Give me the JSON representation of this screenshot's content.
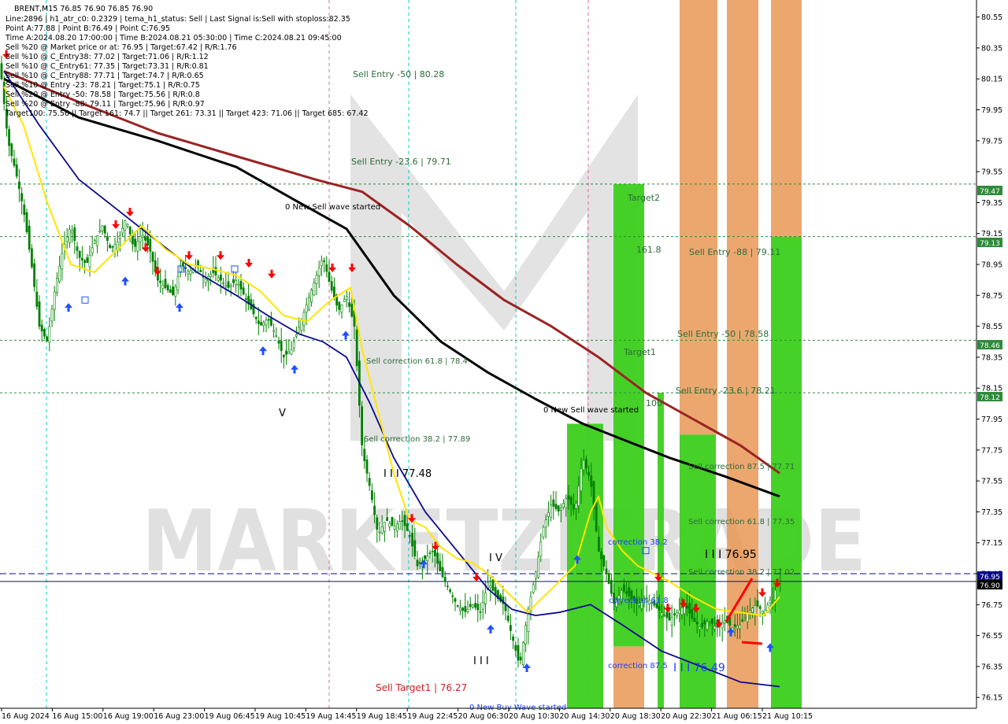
{
  "info_panel": {
    "line0": "BRENT,M15  76.85 76.90 76.85 76.90",
    "line1": "Line:2896 | h1_atr_c0: 0.2329 | tema_h1_status: Sell | Last Signal is:Sell with stoploss:82.35",
    "line2": "Point A:77.88 | Point B:76.49 | Point C:76.95",
    "line3": "Time A:2024.08.20 17:00:00 | Time B:2024.08.21 05:30:00 | Time C:2024.08.21 09:45:00",
    "line4": "Sell %20 @ Market price or at: 76.95 | Target:67.42 | R/R:1.76",
    "line5": "Sell %10 @ C_Entry38: 77.02 | Target:71.06 | R/R:1.12",
    "line6": "Sell %10 @ C_Entry61: 77.35 | Target:73.31 | R/R:0.81",
    "line7": "Sell %10 @ C_Entry88: 77.71 | Target:74.7 | R/R:0.65",
    "line8": "Sell %10 @ Entry -23: 78.21 | Target:75.1 | R/R:0.75",
    "line9": "Sell %20 @ Entry -50: 78.58 | Target:75.56 | R/R:0.8",
    "line10": "Sell %20 @ Entry -88: 79.11 | Target:75.96 | R/R:0.97",
    "line11": "Target100: 75.56 || Target 161: 74.7 || Target 261: 73.31 || Target 423: 71.06 || Target 685: 67.42"
  },
  "annotations": {
    "sell_entry_50_top": "Sell Entry -50 | 80.28",
    "sell_entry_236_top": "Sell Entry -23.6 | 79.71",
    "new_sell_wave_1": "0 New Sell wave started",
    "new_sell_wave_2": "0 New Sell wave started",
    "target2": "Target2",
    "fib_1618": "161.8",
    "target1": "Target1",
    "fib_100": "100",
    "sell_entry_88": "Sell Entry -88 | 79.11",
    "sell_entry_50": "Sell Entry -50 | 78.58",
    "sell_entry_236": "Sell Entry -23.6 | 78.21",
    "sell_corr_618_left": "Sell correction 61.8 | 78.4",
    "sell_corr_382_left": "Sell correction 38.2 | 77.89",
    "wave_iii_label": "I I I  77.48",
    "wave_v": "V",
    "wave_iv": "I V",
    "wave_iii_low": "I I I",
    "sell_target1": "Sell Target1 | 76.27",
    "new_buy_wave": "0 New Buy Wave started",
    "correction_382": "correction 38.2",
    "correction_618": "correction 61.8",
    "correction_875": "correction 87.5",
    "wave_iii_7649": "I I I  76.49",
    "sell_corr_875_right": "Sell correction 87.5 | 77.71",
    "sell_corr_618_right": "Sell correction 61.8 | 77.35",
    "sell_corr_382_right": "Sell correction 38.2 | 77.02",
    "wave_iii_7695": "I I I  76.95",
    "watermark": "MARKETZITRADE"
  },
  "price_badges": {
    "p7947": "79.47",
    "p7913": "79.13",
    "p7846": "78.46",
    "p7812": "78.12",
    "p7695": "76.95",
    "p7690": "76.90"
  },
  "colors": {
    "candle": "#008000",
    "ma_black": "#000000",
    "ma_red": "#9b2323",
    "ma_navy": "#0a0a8c",
    "ma_yellow": "#ffe600",
    "green_zone": "#3ccf1e",
    "orange_zone": "#e8944f",
    "sell_arrow": "#ff0000",
    "buy_arrow": "#1e50ff",
    "badge_green": "#2e8b3a",
    "badge_navy": "#0a0a8c"
  },
  "chart_data": {
    "type": "candlestick",
    "symbol": "BRENT",
    "timeframe": "M15",
    "ylim": [
      76.08,
      80.66
    ],
    "y_ticks": [
      "80.55",
      "80.35",
      "80.15",
      "79.95",
      "79.75",
      "79.55",
      "79.35",
      "79.15",
      "78.95",
      "78.75",
      "78.55",
      "78.35",
      "78.15",
      "77.95",
      "77.75",
      "77.55",
      "77.35",
      "77.15",
      "76.95",
      "76.75",
      "76.55",
      "76.35",
      "76.15"
    ],
    "x_ticks": [
      "16 Aug 2024",
      "16 Aug 15:00",
      "16 Aug 19:00",
      "16 Aug 23:00",
      "19 Aug 06:45",
      "19 Aug 10:45",
      "19 Aug 14:45",
      "19 Aug 18:45",
      "19 Aug 22:45",
      "20 Aug 06:30",
      "20 Aug 10:30",
      "20 Aug 14:30",
      "20 Aug 18:30",
      "20 Aug 22:30",
      "21 Aug 06:15",
      "21 Aug 10:15"
    ],
    "horizontal_levels": [
      79.47,
      79.13,
      78.46,
      78.12,
      76.95,
      76.9
    ],
    "close_path": [
      [
        0,
        80.25
      ],
      [
        10,
        79.75
      ],
      [
        20,
        79.55
      ],
      [
        30,
        79.3
      ],
      [
        40,
        78.95
      ],
      [
        50,
        78.55
      ],
      [
        60,
        78.45
      ],
      [
        70,
        78.8
      ],
      [
        80,
        79.05
      ],
      [
        90,
        79.2
      ],
      [
        100,
        79.0
      ],
      [
        110,
        78.95
      ],
      [
        120,
        79.1
      ],
      [
        130,
        79.2
      ],
      [
        140,
        79.05
      ],
      [
        150,
        79.1
      ],
      [
        160,
        79.25
      ],
      [
        170,
        79.05
      ],
      [
        180,
        79.15
      ],
      [
        190,
        79.05
      ],
      [
        200,
        78.85
      ],
      [
        210,
        78.8
      ],
      [
        220,
        78.75
      ],
      [
        230,
        78.95
      ],
      [
        240,
        78.9
      ],
      [
        250,
        78.95
      ],
      [
        260,
        78.85
      ],
      [
        270,
        78.9
      ],
      [
        280,
        78.85
      ],
      [
        290,
        78.8
      ],
      [
        300,
        78.85
      ],
      [
        310,
        78.75
      ],
      [
        320,
        78.65
      ],
      [
        330,
        78.55
      ],
      [
        340,
        78.6
      ],
      [
        350,
        78.5
      ],
      [
        360,
        78.35
      ],
      [
        370,
        78.4
      ],
      [
        380,
        78.55
      ],
      [
        390,
        78.7
      ],
      [
        400,
        78.85
      ],
      [
        410,
        79.0
      ],
      [
        420,
        78.8
      ],
      [
        430,
        78.65
      ],
      [
        440,
        78.75
      ],
      [
        450,
        78.55
      ],
      [
        460,
        77.75
      ],
      [
        470,
        77.5
      ],
      [
        480,
        77.2
      ],
      [
        490,
        77.3
      ],
      [
        500,
        77.25
      ],
      [
        510,
        77.3
      ],
      [
        520,
        77.2
      ],
      [
        530,
        77.0
      ],
      [
        540,
        77.05
      ],
      [
        550,
        77.1
      ],
      [
        560,
        76.95
      ],
      [
        570,
        76.85
      ],
      [
        580,
        76.75
      ],
      [
        590,
        76.7
      ],
      [
        600,
        76.75
      ],
      [
        610,
        76.7
      ],
      [
        620,
        76.9
      ],
      [
        630,
        76.8
      ],
      [
        640,
        76.75
      ],
      [
        650,
        76.55
      ],
      [
        660,
        76.35
      ],
      [
        670,
        76.7
      ],
      [
        680,
        76.95
      ],
      [
        690,
        77.25
      ],
      [
        700,
        77.4
      ],
      [
        710,
        77.35
      ],
      [
        720,
        77.45
      ],
      [
        730,
        77.35
      ],
      [
        740,
        77.7
      ],
      [
        750,
        77.55
      ],
      [
        760,
        77.1
      ],
      [
        770,
        76.95
      ],
      [
        780,
        76.75
      ],
      [
        790,
        76.85
      ],
      [
        800,
        76.8
      ],
      [
        810,
        76.75
      ],
      [
        820,
        76.8
      ],
      [
        830,
        76.75
      ],
      [
        840,
        76.7
      ],
      [
        850,
        76.65
      ],
      [
        860,
        76.7
      ],
      [
        870,
        76.75
      ],
      [
        880,
        76.65
      ],
      [
        890,
        76.6
      ],
      [
        900,
        76.65
      ],
      [
        910,
        76.6
      ],
      [
        920,
        76.65
      ],
      [
        930,
        76.6
      ],
      [
        940,
        76.62
      ],
      [
        950,
        76.7
      ],
      [
        960,
        76.75
      ],
      [
        970,
        76.7
      ],
      [
        980,
        76.8
      ],
      [
        990,
        76.9
      ]
    ],
    "ma_black": [
      [
        5,
        80.15
      ],
      [
        100,
        79.9
      ],
      [
        200,
        79.75
      ],
      [
        300,
        79.58
      ],
      [
        380,
        79.35
      ],
      [
        440,
        79.18
      ],
      [
        500,
        78.75
      ],
      [
        560,
        78.45
      ],
      [
        620,
        78.25
      ],
      [
        680,
        78.08
      ],
      [
        740,
        77.92
      ],
      [
        790,
        77.82
      ],
      [
        850,
        77.7
      ],
      [
        920,
        77.58
      ],
      [
        990,
        77.45
      ]
    ],
    "ma_red": [
      [
        5,
        80.2
      ],
      [
        100,
        80.0
      ],
      [
        200,
        79.8
      ],
      [
        300,
        79.65
      ],
      [
        400,
        79.5
      ],
      [
        460,
        79.42
      ],
      [
        520,
        79.2
      ],
      [
        580,
        78.95
      ],
      [
        640,
        78.72
      ],
      [
        700,
        78.55
      ],
      [
        760,
        78.35
      ],
      [
        820,
        78.12
      ],
      [
        880,
        77.95
      ],
      [
        940,
        77.78
      ],
      [
        990,
        77.6
      ]
    ],
    "ma_navy": [
      [
        5,
        80.2
      ],
      [
        50,
        79.85
      ],
      [
        100,
        79.5
      ],
      [
        150,
        79.3
      ],
      [
        200,
        79.1
      ],
      [
        250,
        78.9
      ],
      [
        300,
        78.75
      ],
      [
        340,
        78.62
      ],
      [
        380,
        78.5
      ],
      [
        410,
        78.45
      ],
      [
        440,
        78.35
      ],
      [
        470,
        78.05
      ],
      [
        500,
        77.7
      ],
      [
        540,
        77.35
      ],
      [
        580,
        77.1
      ],
      [
        620,
        76.85
      ],
      [
        650,
        76.72
      ],
      [
        680,
        76.68
      ],
      [
        710,
        76.7
      ],
      [
        750,
        76.75
      ],
      [
        790,
        76.62
      ],
      [
        840,
        76.45
      ],
      [
        890,
        76.35
      ],
      [
        940,
        76.25
      ],
      [
        990,
        76.22
      ]
    ],
    "ma_yellow": [
      [
        5,
        80.1
      ],
      [
        30,
        79.85
      ],
      [
        60,
        79.35
      ],
      [
        90,
        78.95
      ],
      [
        120,
        78.9
      ],
      [
        150,
        79.05
      ],
      [
        180,
        79.2
      ],
      [
        210,
        79.05
      ],
      [
        240,
        78.95
      ],
      [
        270,
        78.92
      ],
      [
        300,
        78.88
      ],
      [
        330,
        78.78
      ],
      [
        360,
        78.62
      ],
      [
        390,
        78.58
      ],
      [
        420,
        78.72
      ],
      [
        445,
        78.8
      ],
      [
        460,
        78.4
      ],
      [
        480,
        78.0
      ],
      [
        500,
        77.6
      ],
      [
        520,
        77.3
      ],
      [
        540,
        77.25
      ],
      [
        560,
        77.12
      ],
      [
        580,
        77.05
      ],
      [
        600,
        77.02
      ],
      [
        620,
        76.95
      ],
      [
        650,
        76.8
      ],
      [
        670,
        76.7
      ],
      [
        700,
        76.85
      ],
      [
        730,
        77.0
      ],
      [
        750,
        77.35
      ],
      [
        760,
        77.45
      ],
      [
        770,
        77.25
      ],
      [
        790,
        77.1
      ],
      [
        810,
        77.0
      ],
      [
        830,
        76.95
      ],
      [
        850,
        76.9
      ],
      [
        880,
        76.8
      ],
      [
        910,
        76.72
      ],
      [
        940,
        76.7
      ],
      [
        970,
        76.68
      ],
      [
        990,
        76.8
      ]
    ],
    "zones": [
      {
        "color": "green",
        "x0": 720,
        "x1": 766,
        "top": 77.92,
        "bottom": 76.08
      },
      {
        "color": "green",
        "x0": 779,
        "x1": 818,
        "top": 79.47,
        "bottom": 76.48
      },
      {
        "color": "green",
        "x0": 835,
        "x1": 843,
        "top": 78.12,
        "bottom": 76.08
      },
      {
        "color": "green",
        "x0": 979,
        "x1": 1018,
        "top": 79.13,
        "bottom": 76.08
      },
      {
        "color": "green",
        "x0": 863,
        "x1": 909,
        "top": 77.85,
        "bottom": 76.08
      },
      {
        "color": "orange",
        "x0": 779,
        "x1": 818,
        "top": 76.48,
        "bottom": 76.08
      },
      {
        "color": "orange",
        "x0": 863,
        "x1": 911,
        "top": 80.66,
        "bottom": 77.85
      },
      {
        "color": "orange",
        "x0": 923,
        "x1": 963,
        "top": 80.66,
        "bottom": 76.08
      },
      {
        "color": "orange",
        "x0": 979,
        "x1": 1018,
        "top": 80.66,
        "bottom": 79.13
      }
    ],
    "sell_arrows": [
      [
        8,
        80.3
      ],
      [
        147,
        79.2
      ],
      [
        165,
        79.28
      ],
      [
        185,
        79.05
      ],
      [
        200,
        78.9
      ],
      [
        240,
        79.0
      ],
      [
        280,
        79.0
      ],
      [
        316,
        78.95
      ],
      [
        345,
        78.88
      ],
      [
        422,
        78.92
      ],
      [
        447,
        78.92
      ],
      [
        523,
        77.3
      ],
      [
        553,
        77.12
      ],
      [
        605,
        76.92
      ],
      [
        836,
        76.92
      ],
      [
        848,
        76.72
      ],
      [
        868,
        76.75
      ],
      [
        884,
        76.72
      ],
      [
        913,
        76.62
      ],
      [
        968,
        76.82
      ],
      [
        987,
        76.88
      ]
    ],
    "buy_arrows": [
      [
        87,
        78.68
      ],
      [
        159,
        78.85
      ],
      [
        228,
        78.68
      ],
      [
        334,
        78.4
      ],
      [
        374,
        78.28
      ],
      [
        439,
        78.5
      ],
      [
        538,
        77.02
      ],
      [
        623,
        76.6
      ],
      [
        669,
        76.35
      ],
      [
        733,
        77.05
      ],
      [
        928,
        76.58
      ],
      [
        978,
        76.48
      ]
    ],
    "fractal_tags": [
      [
        108,
        78.72
      ],
      [
        230,
        78.92
      ],
      [
        298,
        78.92
      ],
      [
        820,
        77.1
      ]
    ]
  }
}
